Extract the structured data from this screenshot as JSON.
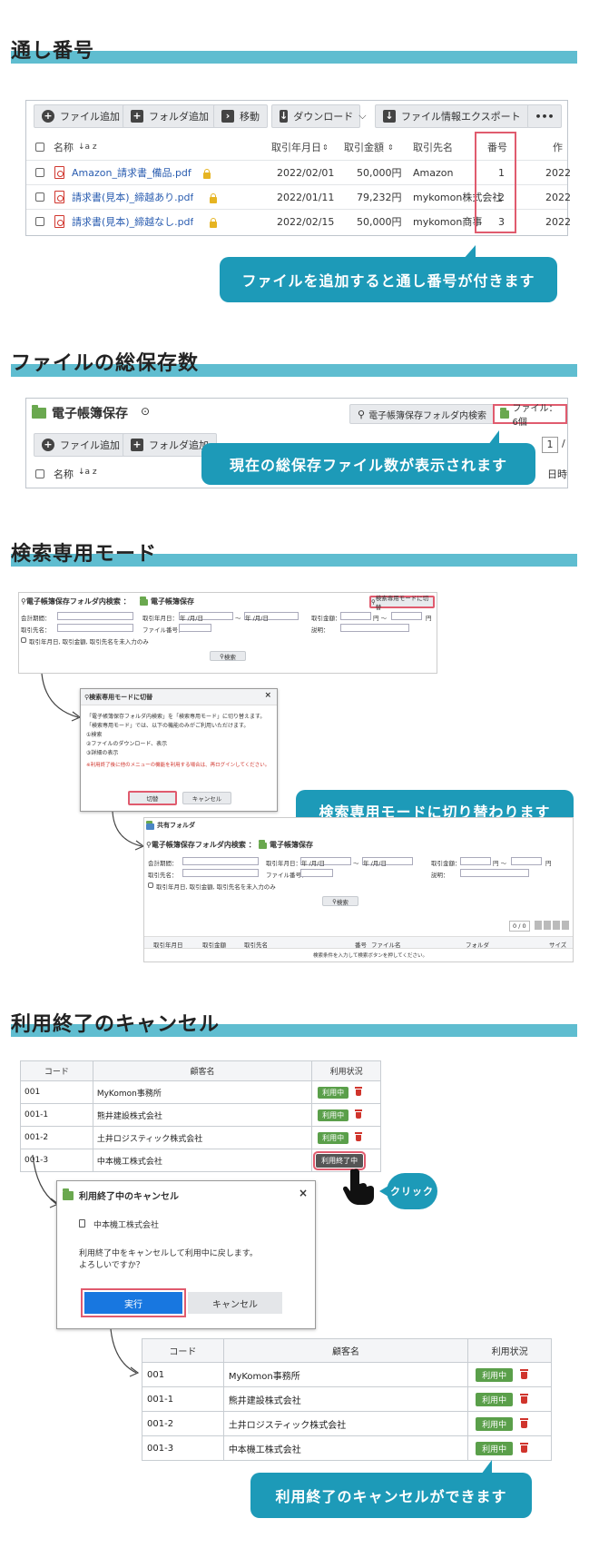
{
  "sections": {
    "s1_title": "通し番号",
    "s2_title": "ファイルの総保存数",
    "s3_title": "検索専用モード",
    "s4_title": "利用終了のキャンセル"
  },
  "toolbar1": {
    "add_file": "ファイル追加",
    "add_folder": "フォルダ追加",
    "move": "移動",
    "download": "ダウンロード",
    "export": "ファイル情報エクスポート",
    "more": "•••"
  },
  "filetable": {
    "headers": {
      "name": "名称",
      "sort": "↓a z",
      "date": "取引年月日",
      "amount": "取引金額",
      "partner": "取引先名",
      "number": "番号",
      "cut": "作"
    },
    "rows": [
      {
        "name": "Amazon_請求書_備品.pdf",
        "date": "2022/02/01",
        "amount": "50,000円",
        "partner": "Amazon",
        "number": "1",
        "cut": "2022"
      },
      {
        "name": "請求書(見本)_締越あり.pdf",
        "date": "2022/01/11",
        "amount": "79,232円",
        "partner": "mykomon株式会社",
        "number": "2",
        "cut": "2022"
      },
      {
        "name": "請求書(見本)_締越なし.pdf",
        "date": "2022/02/15",
        "amount": "50,000円",
        "partner": "mykomon商事",
        "number": "3",
        "cut": "2022"
      }
    ]
  },
  "callouts": {
    "c1": "ファイルを追加すると通し番号が付きます",
    "c2": "現在の総保存ファイル数が表示されます",
    "c3": "検索専用モードに切り替わります",
    "c4": "利用終了のキャンセルができます",
    "click": "クリック"
  },
  "storage": {
    "folder_title": "電子帳簿保存",
    "search_btn": "電子帳簿保存フォルダ内検索",
    "file_count": "ファイル：6個",
    "add_file": "ファイル追加",
    "add_folder": "フォルダ追加",
    "page_value": "1",
    "page_sep": "/",
    "name_header": "名称",
    "sort": "↓a z",
    "date_cut": "日時"
  },
  "search": {
    "title_prefix": "電子帳簿保存フォルダ内検索 ：",
    "folder": "電子帳簿保存",
    "mode_btn": "検索専用モードに切替",
    "period_label": "会計期間：",
    "date_label": "取引年月日：",
    "date_ph": "年 /月/日",
    "tilde": "～",
    "amount_label": "取引金額：",
    "yen_tilde": "円 ～",
    "yen": "円",
    "partner_label": "取引先名：",
    "fileno_label": "ファイル番号：",
    "desc_label": "説明：",
    "check_label": "取引年月日, 取引金額, 取引先名を未入力のみ",
    "search_btn": "検索"
  },
  "mode_dialog": {
    "title": "検索専用モードに切替",
    "line1": "「電子帳簿保存フォルダ内検索」を「検索専用モード」に切り替えます。",
    "line2": "「検索専用モード」では、以下の機能のみがご利用いただけます。",
    "item1": "①検索",
    "item2": "②ファイルのダウンロード、表示",
    "item3": "③詳細の表示",
    "note": "※利用終了後に他のメニューの機能を利用する場合は、再ログインしてください。",
    "ok": "切替",
    "cancel": "キャンセル",
    "close": "×"
  },
  "search2": {
    "shared": "共有フォルダ",
    "pager": "0 / 0",
    "col_date": "取引年月日",
    "col_amount": "取引金額",
    "col_partner": "取引先名",
    "col_no": "番号",
    "col_file": "ファイル名",
    "col_folder": "フォルダ",
    "col_size": "サイズ",
    "empty": "検索条件を入力して検索ボタンを押してください。"
  },
  "cust1": {
    "headers": [
      "コード",
      "顧客名",
      "利用状況"
    ],
    "rows": [
      {
        "code": "001",
        "name": "MyKomon事務所",
        "status": "利用中"
      },
      {
        "code": "001-1",
        "name": "熊井建設株式会社",
        "status": "利用中"
      },
      {
        "code": "001-2",
        "name": "土井ロジスティック株式会社",
        "status": "利用中"
      },
      {
        "code": "001-3",
        "name": "中本機工株式会社",
        "status": "利用終了中"
      }
    ]
  },
  "cancel_dialog": {
    "title": "利用終了中のキャンセル",
    "close": "×",
    "company": "中本機工株式会社",
    "msg1": "利用終了中をキャンセルして利用中に戻します。",
    "msg2": "よろしいですか？",
    "exec": "実行",
    "cancel": "キャンセル"
  },
  "cust2": {
    "headers": [
      "コード",
      "顧客名",
      "利用状況"
    ],
    "rows": [
      {
        "code": "001",
        "name": "MyKomon事務所",
        "status": "利用中"
      },
      {
        "code": "001-1",
        "name": "熊井建設株式会社",
        "status": "利用中"
      },
      {
        "code": "001-2",
        "name": "土井ロジスティック株式会社",
        "status": "利用中"
      },
      {
        "code": "001-3",
        "name": "中本機工株式会社",
        "status": "利用中"
      }
    ]
  },
  "colors": {
    "accent": "#1d9ab8",
    "bar": "#5fbdd0",
    "highlight": "#e05b6e",
    "green": "#5a9f4a",
    "pdf": "#d0342c"
  }
}
